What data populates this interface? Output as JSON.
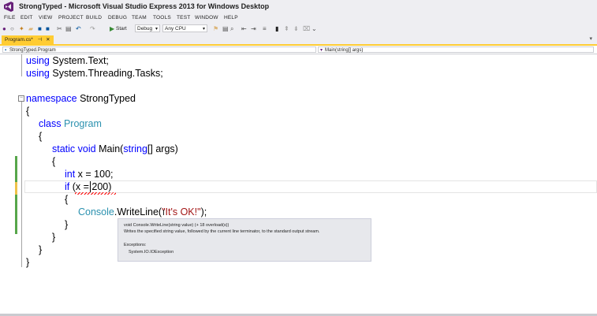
{
  "window": {
    "title": "StrongTyped - Microsoft Visual Studio Express 2013 for Windows Desktop"
  },
  "menu": [
    "FILE",
    "EDIT",
    "VIEW",
    "PROJECT",
    "BUILD",
    "DEBUG",
    "TEAM",
    "TOOLS",
    "TEST",
    "WINDOW",
    "HELP"
  ],
  "toolbar": {
    "start_label": "Start",
    "config_value": "Debug",
    "platform_value": "Any CPU"
  },
  "tab": {
    "label": "Program.cs*"
  },
  "navigation": {
    "type_scope": "StrongTyped.Program",
    "member_scope": "Main(string[] args)"
  },
  "code": {
    "line1": {
      "kw": "using",
      "rest": " System.Text;"
    },
    "line2": {
      "kw": "using",
      "rest": " System.Threading.Tasks;"
    },
    "ns": {
      "kw": "namespace",
      "rest": " StrongTyped"
    },
    "brace_open": "{",
    "brace_close": "}",
    "cls": {
      "kw": "class",
      "name": "Program"
    },
    "main": {
      "kw1": "static",
      "kw2": "void",
      "name": " Main(",
      "kw3": "string",
      "rest": "[] args)"
    },
    "decl": {
      "kw": "int",
      "rest": " x = 100;"
    },
    "cond": {
      "kw": "if",
      "rest": " (x = 200)"
    },
    "call": {
      "type": "Console",
      "method": ".WriteLine(",
      "str": "\"It's OK!\"",
      "end": ");"
    }
  },
  "tooltip": {
    "signature": "void Console.WriteLine(string value)  (+ 18 overload(s))",
    "description": "Writes the specified string value, followed by the current line terminator, to the standard output stream.",
    "exceptions_label": "Exceptions:",
    "exception": "System.IO.IOException"
  },
  "colors": {
    "keyword": "#0000ff",
    "type": "#2b91af",
    "string": "#a31515",
    "saved_change": "#57a64a",
    "unsaved_change": "#efc24a",
    "active_tab": "#ffcc33"
  }
}
